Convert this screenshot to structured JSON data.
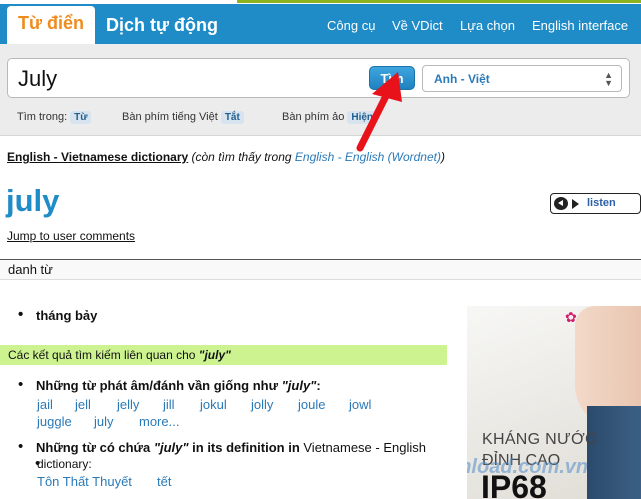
{
  "header": {
    "tabs": [
      {
        "label": "Từ điển"
      },
      {
        "label": "Dịch tự động"
      }
    ],
    "nav": [
      {
        "label": "Công cụ"
      },
      {
        "label": "Về VDict"
      },
      {
        "label": "Lựa chọn"
      },
      {
        "label": "English interface"
      }
    ]
  },
  "search": {
    "value": "July",
    "button_label": "Tìm",
    "language": "Anh - Việt",
    "options": [
      {
        "label": "Tìm trong:",
        "value": "Từ"
      },
      {
        "label": "Bàn phím tiếng Việt",
        "value": "Tắt"
      },
      {
        "label": "Bàn phím ảo",
        "value": "Hiện"
      }
    ]
  },
  "result": {
    "source_dict": "English - Vietnamese dictionary",
    "also_found_prefix": "(còn tìm thấy trong ",
    "also_found_link": "English - English (Wordnet)",
    "also_found_suffix": ")",
    "headword": "july",
    "listen_label": "listen",
    "jump_label": "Jump to user comments",
    "part_of_speech": "danh từ",
    "meaning": "tháng bảy",
    "related_prefix": "Các kết quả tìm kiếm liên quan cho ",
    "related_term": "\"july\"",
    "sound_alike": {
      "heading_pre": "Những từ phát âm/đánh vần giống như ",
      "heading_term": "\"july\"",
      "heading_post": ":",
      "words": [
        "jail",
        "jell",
        "jelly",
        "jill",
        "jokul",
        "jolly",
        "joule",
        "jowl",
        "juggle",
        "july",
        "more..."
      ]
    },
    "containing": {
      "heading_pre": "Những từ có chứa ",
      "heading_term": "\"july\"",
      "heading_mid": " in its definition in ",
      "heading_dict": "Vietnamese - English",
      "heading_line2": "dictionary:",
      "words": [
        "Tôn Thất Thuyết",
        "tết"
      ]
    }
  },
  "ad": {
    "line1": "KHÁNG NƯỚC",
    "line2": "ĐỈNH CAO",
    "line3": "IP68"
  },
  "watermark": "Download.com.vn"
}
